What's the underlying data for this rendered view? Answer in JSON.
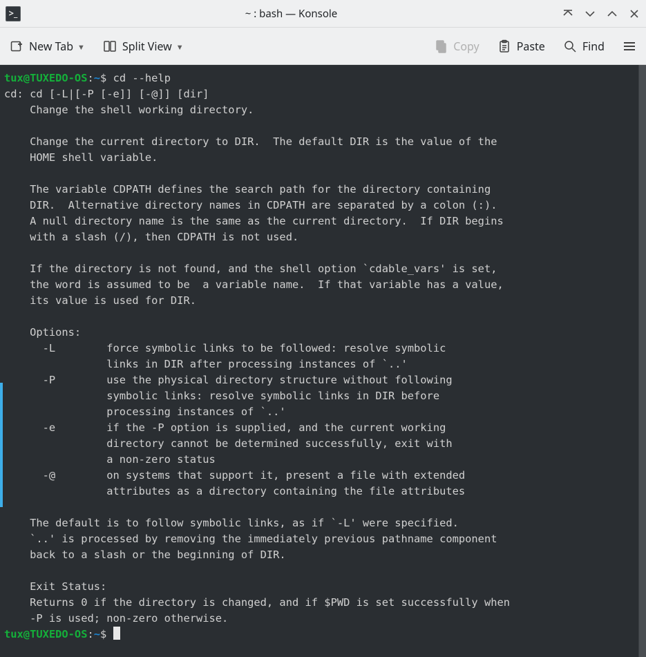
{
  "window": {
    "title": "~ : bash — Konsole"
  },
  "toolbar": {
    "new_tab": "New Tab",
    "split_view": "Split View",
    "copy": "Copy",
    "paste": "Paste",
    "find": "Find"
  },
  "prompt": {
    "userhost": "tux@TUXEDO-OS",
    "sep1": ":",
    "path": "~",
    "sep2": "$ "
  },
  "command": "cd --help",
  "output_lines": [
    "cd: cd [-L|[-P [-e]] [-@]] [dir]",
    "    Change the shell working directory.",
    "    ",
    "    Change the current directory to DIR.  The default DIR is the value of the",
    "    HOME shell variable.",
    "    ",
    "    The variable CDPATH defines the search path for the directory containing",
    "    DIR.  Alternative directory names in CDPATH are separated by a colon (:).",
    "    A null directory name is the same as the current directory.  If DIR begins",
    "    with a slash (/), then CDPATH is not used.",
    "    ",
    "    If the directory is not found, and the shell option `cdable_vars' is set,",
    "    the word is assumed to be  a variable name.  If that variable has a value,",
    "    its value is used for DIR.",
    "    ",
    "    Options:",
    "      -L        force symbolic links to be followed: resolve symbolic",
    "                links in DIR after processing instances of `..'",
    "      -P        use the physical directory structure without following",
    "                symbolic links: resolve symbolic links in DIR before",
    "                processing instances of `..'",
    "      -e        if the -P option is supplied, and the current working",
    "                directory cannot be determined successfully, exit with",
    "                a non-zero status",
    "      -@        on systems that support it, present a file with extended",
    "                attributes as a directory containing the file attributes",
    "    ",
    "    The default is to follow symbolic links, as if `-L' were specified.",
    "    `..' is processed by removing the immediately previous pathname component",
    "    back to a slash or the beginning of DIR.",
    "    ",
    "    Exit Status:",
    "    Returns 0 if the directory is changed, and if $PWD is set successfully when",
    "    -P is used; non-zero otherwise."
  ]
}
